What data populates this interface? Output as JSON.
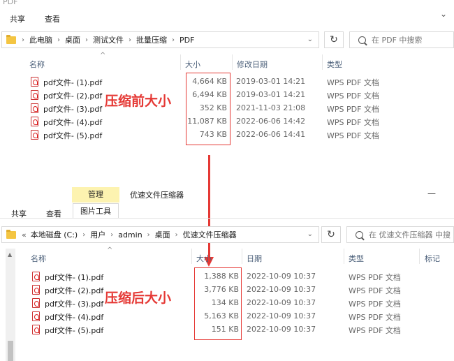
{
  "win1": {
    "title": "PDF",
    "tabs": [
      "共享",
      "查看"
    ],
    "path": [
      "此电脑",
      "桌面",
      "测试文件",
      "批量压缩",
      "PDF"
    ],
    "search_placeholder": "在 PDF 中搜索",
    "columns": {
      "name": "名称",
      "size": "大小",
      "date": "修改日期",
      "type": "类型"
    },
    "files": [
      {
        "name": "pdf文件- (1).pdf",
        "size": "4,664 KB",
        "date": "2019-03-01 14:21",
        "type": "WPS PDF 文档"
      },
      {
        "name": "pdf文件- (2).pdf",
        "size": "6,494 KB",
        "date": "2019-03-01 14:21",
        "type": "WPS PDF 文档"
      },
      {
        "name": "pdf文件- (3).pdf",
        "size": "352 KB",
        "date": "2021-11-03 21:08",
        "type": "WPS PDF 文档"
      },
      {
        "name": "pdf文件- (4).pdf",
        "size": "11,087 KB",
        "date": "2022-06-06 14:42",
        "type": "WPS PDF 文档"
      },
      {
        "name": "pdf文件- (5).pdf",
        "size": "743 KB",
        "date": "2022-06-06 14:41",
        "type": "WPS PDF 文档"
      }
    ],
    "annotation": "压缩前大小"
  },
  "win2": {
    "context_tab": "管理",
    "title": "优速文件压缩器",
    "tabs": [
      "共享",
      "查看"
    ],
    "tool_tab": "图片工具",
    "path_prefix": "«",
    "path": [
      "本地磁盘 (C:)",
      "用户",
      "admin",
      "桌面",
      "优速文件压缩器"
    ],
    "search_placeholder": "在 优速文件压缩器 中搜",
    "columns": {
      "name": "名称",
      "size": "大小",
      "date": "日期",
      "type": "类型",
      "tag": "标记"
    },
    "files": [
      {
        "name": "pdf文件- (1).pdf",
        "size": "1,388 KB",
        "date": "2022-10-09 10:37",
        "type": "WPS PDF 文档"
      },
      {
        "name": "pdf文件- (2).pdf",
        "size": "3,776 KB",
        "date": "2022-10-09 10:37",
        "type": "WPS PDF 文档"
      },
      {
        "name": "pdf文件- (3).pdf",
        "size": "134 KB",
        "date": "2022-10-09 10:37",
        "type": "WPS PDF 文档"
      },
      {
        "name": "pdf文件- (4).pdf",
        "size": "5,163 KB",
        "date": "2022-10-09 10:37",
        "type": "WPS PDF 文档"
      },
      {
        "name": "pdf文件- (5).pdf",
        "size": "151 KB",
        "date": "2022-10-09 10:37",
        "type": "WPS PDF 文档"
      }
    ],
    "annotation": "压缩后大小"
  },
  "icons": {
    "refresh": "↻",
    "minimize": "—",
    "chevron_down": "⌃"
  },
  "colors": {
    "annotation_red": "#e53935",
    "manage_tab": "#fdf3b0",
    "header_text": "#4c607a"
  }
}
